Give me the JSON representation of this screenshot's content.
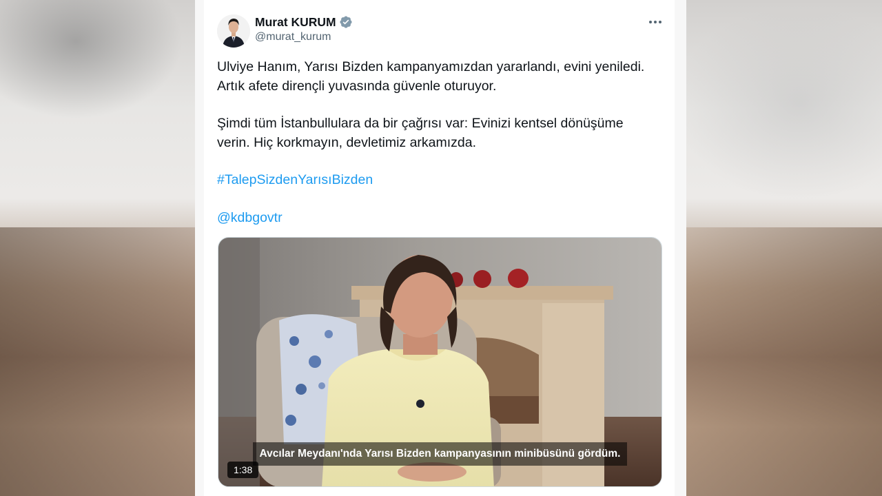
{
  "tweet": {
    "author_name": "Murat KURUM",
    "author_handle": "@murat_kurum",
    "paragraph1": "Ulviye Hanım, Yarısı Bizden kampanyamızdan yararlandı, evini yeniledi. Artık afete dirençli yuvasında güvenle oturuyor.",
    "paragraph2": "Şimdi tüm İstanbullulara da bir çağrısı var: Evinizi kentsel dönüşüme verin. Hiç korkmayın, devletimiz arkamızda.",
    "hashtag": "#TalepSizdenYarısıBizden",
    "mention": "@kdbgovtr"
  },
  "video": {
    "caption": "Avcılar Meydanı'nda Yarısı Bizden kampanyasının minibüsünü gördüm.",
    "duration": "1:38"
  },
  "icons": {
    "verified": "verified-badge-icon",
    "more": "more-options-icon"
  },
  "colors": {
    "link": "#1d9bf0",
    "verified_badge": "#829aab",
    "text": "#0f1419",
    "secondary": "#536471"
  }
}
